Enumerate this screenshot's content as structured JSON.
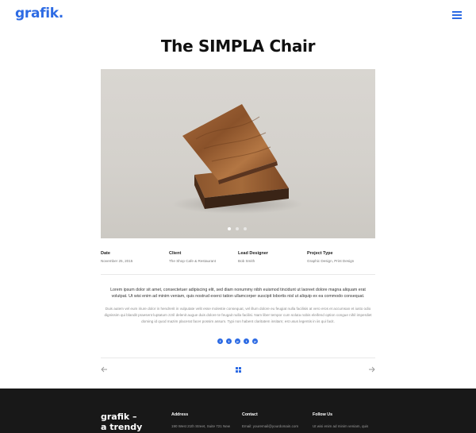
{
  "header": {
    "logo": "grafik."
  },
  "page": {
    "title": "The SIMPLA Chair"
  },
  "carousel": {
    "slide_count": 3,
    "active_index": 0
  },
  "meta": [
    {
      "label": "Date",
      "value": "November 25, 2015"
    },
    {
      "label": "Client",
      "value": "The Shop Cafe & Restaurant"
    },
    {
      "label": "Lead Designer",
      "value": "Bob Smith"
    },
    {
      "label": "Project Type",
      "value": "Graphic Design, Print Design"
    }
  ],
  "content": {
    "lead": "Lorem ipsum dolor sit amet, consectetuer adipiscing elit, sed diam nonummy nibh euismod tincidunt ut laoreet dolore magna aliquam erat volutpat. Ut wisi enim ad minim veniam, quis nostrud exerci tation ullamcorper suscipit lobortis nisl ut aliquip ex ea commodo consequat.",
    "body": "Duis autem vel eum iriure dolor in hendrerit in vulputate velit esse molestie consequat, vel illum dolore eu feugiat nulla facilisis at vero eros et accumsan et iusto odio dignissim qui blandit praesent luptatum zzril delenit augue duis dolore te feugait nulla facilisi. Nam liber tempor cum soluta nobis eleifend option congue nihil imperdiet doming id quod mazim placerat facer possim assum. Typi non habent claritatem insitam; est usus legentis in iis qui facit."
  },
  "social": [
    {
      "icon": "facebook-icon",
      "glyph": "f"
    },
    {
      "icon": "twitter-icon",
      "glyph": "t"
    },
    {
      "icon": "pinterest-icon",
      "glyph": "p"
    },
    {
      "icon": "tumblr-icon",
      "glyph": "t"
    },
    {
      "icon": "pinterest-icon",
      "glyph": "p"
    }
  ],
  "footer": {
    "brand_line1": "grafik –",
    "brand_line2": "a trendy",
    "address": {
      "heading": "Address",
      "text": "190 West 21th Street, Suite 721 New"
    },
    "contact": {
      "heading": "Contact",
      "text": "Email: youremail@yourdomain.com"
    },
    "follow": {
      "heading": "Follow Us",
      "text": "Ut wisi enim ad minim veniam, quis"
    }
  },
  "colors": {
    "accent": "#2d6be4",
    "footer_bg": "#181818"
  }
}
